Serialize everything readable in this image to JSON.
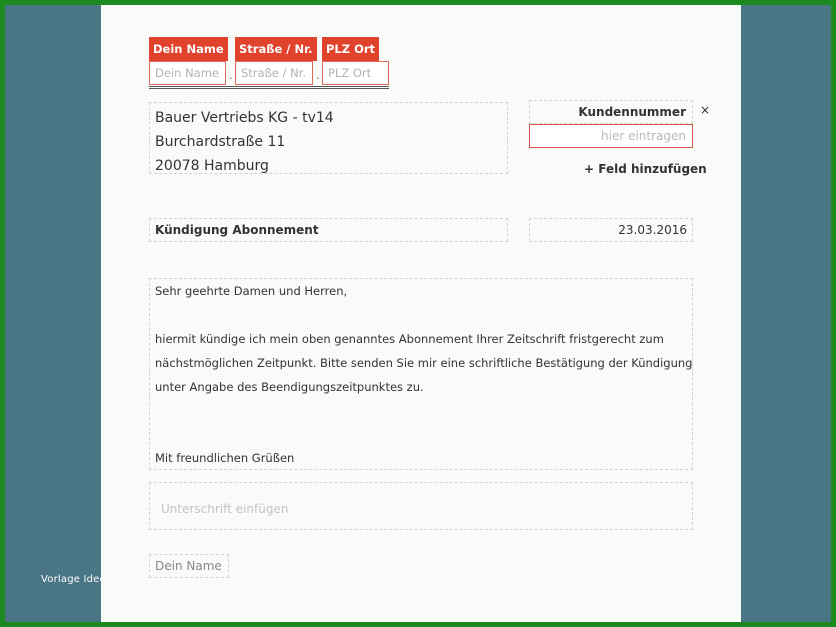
{
  "sender": {
    "name_label": "Dein Name",
    "street_label": "Straße / Nr.",
    "city_label": "PLZ Ort",
    "name_placeholder": "Dein Name",
    "street_placeholder": "Straße / Nr.",
    "city_placeholder": "PLZ Ort",
    "separator": "·"
  },
  "recipient": {
    "line1": "Bauer Vertriebs KG - tv14",
    "line2": "Burchardstraße 11",
    "line3": "20078 Hamburg"
  },
  "customer_number": {
    "label": "Kundennummer",
    "placeholder": "hier eintragen",
    "remove": "×"
  },
  "add_field": "+ Feld hinzufügen",
  "subject": "Kündigung Abonnement",
  "date": "23.03.2016",
  "letter": {
    "greeting": "Sehr geehrte Damen und Herren,",
    "body_line1": "hiermit kündige ich mein oben genanntes Abonnement Ihrer Zeitschrift fristgerecht zum",
    "body_line2": "nächstmöglichen Zeitpunkt. Bitte senden Sie mir eine schriftliche Bestätigung der Kündigung",
    "body_line3": "unter Angabe des Beendigungszeitpunktes zu.",
    "closing": "Mit freundlichen Grüßen"
  },
  "signature_placeholder": "Unterschrift einfügen",
  "signer_name": "Dein Name",
  "watermark": "Vorlage Idee",
  "colors": {
    "accent": "#e0422b",
    "background": "#4a7585",
    "frame": "#1b8a1f"
  }
}
